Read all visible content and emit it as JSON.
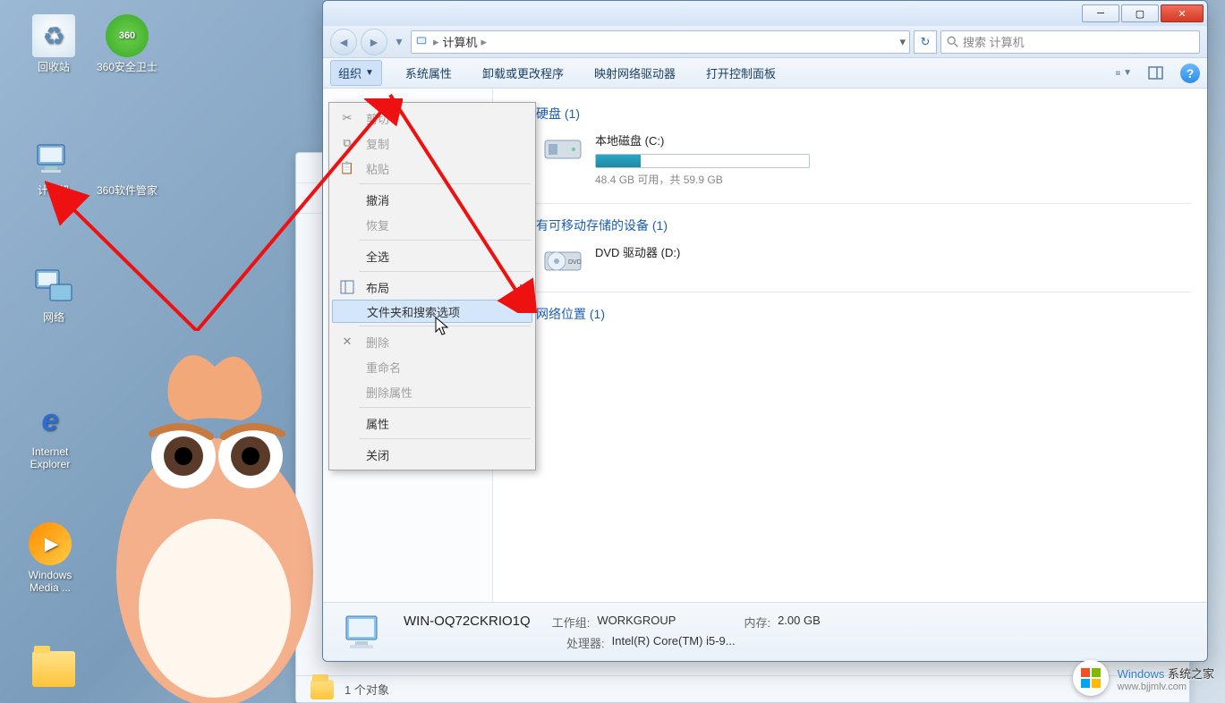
{
  "desktop": {
    "icons": [
      {
        "label": "回收站"
      },
      {
        "label": "360安全卫士"
      },
      {
        "label": "计算机"
      },
      {
        "label": "360软件管家"
      },
      {
        "label": "网络"
      },
      {
        "label": "Internet Explorer"
      },
      {
        "label": "Windows Media ..."
      }
    ]
  },
  "explorer": {
    "breadcrumb": {
      "root_icon": "computer-icon",
      "item": "计算机"
    },
    "search_placeholder": "搜索 计算机",
    "toolbar": {
      "organize": "组织",
      "sys_props": "系统属性",
      "uninstall": "卸载或更改程序",
      "map_drive": "映射网络驱动器",
      "ctrl_panel": "打开控制面板"
    },
    "groups": {
      "hdd_title": "硬盘 (1)",
      "removable_title": "有可移动存储的设备 (1)",
      "network_title": "网络位置 (1)"
    },
    "drive_c": {
      "title": "本地磁盘 (C:)",
      "subtitle": "48.4 GB 可用，共 59.9 GB"
    },
    "drive_d": {
      "title": "DVD 驱动器 (D:)"
    },
    "details": {
      "computer_name": "WIN-OQ72CKRIO1Q",
      "workgroup_lbl": "工作组:",
      "workgroup_val": "WORKGROUP",
      "mem_lbl": "内存:",
      "mem_val": "2.00 GB",
      "cpu_lbl": "处理器:",
      "cpu_val": "Intel(R) Core(TM) i5-9..."
    }
  },
  "bg_window": {
    "status": "1 个对象"
  },
  "menu": {
    "cut": "剪切",
    "copy": "复制",
    "paste": "粘贴",
    "undo": "撤消",
    "redo": "恢复",
    "select_all": "全选",
    "layout": "布局",
    "folder_opts": "文件夹和搜索选项",
    "delete": "删除",
    "rename": "重命名",
    "remove_props": "删除属性",
    "properties": "属性",
    "close": "关闭"
  },
  "watermark": {
    "title_cn": "系统之家",
    "title_prefix": "Windows ",
    "url": "www.bjjmlv.com"
  }
}
